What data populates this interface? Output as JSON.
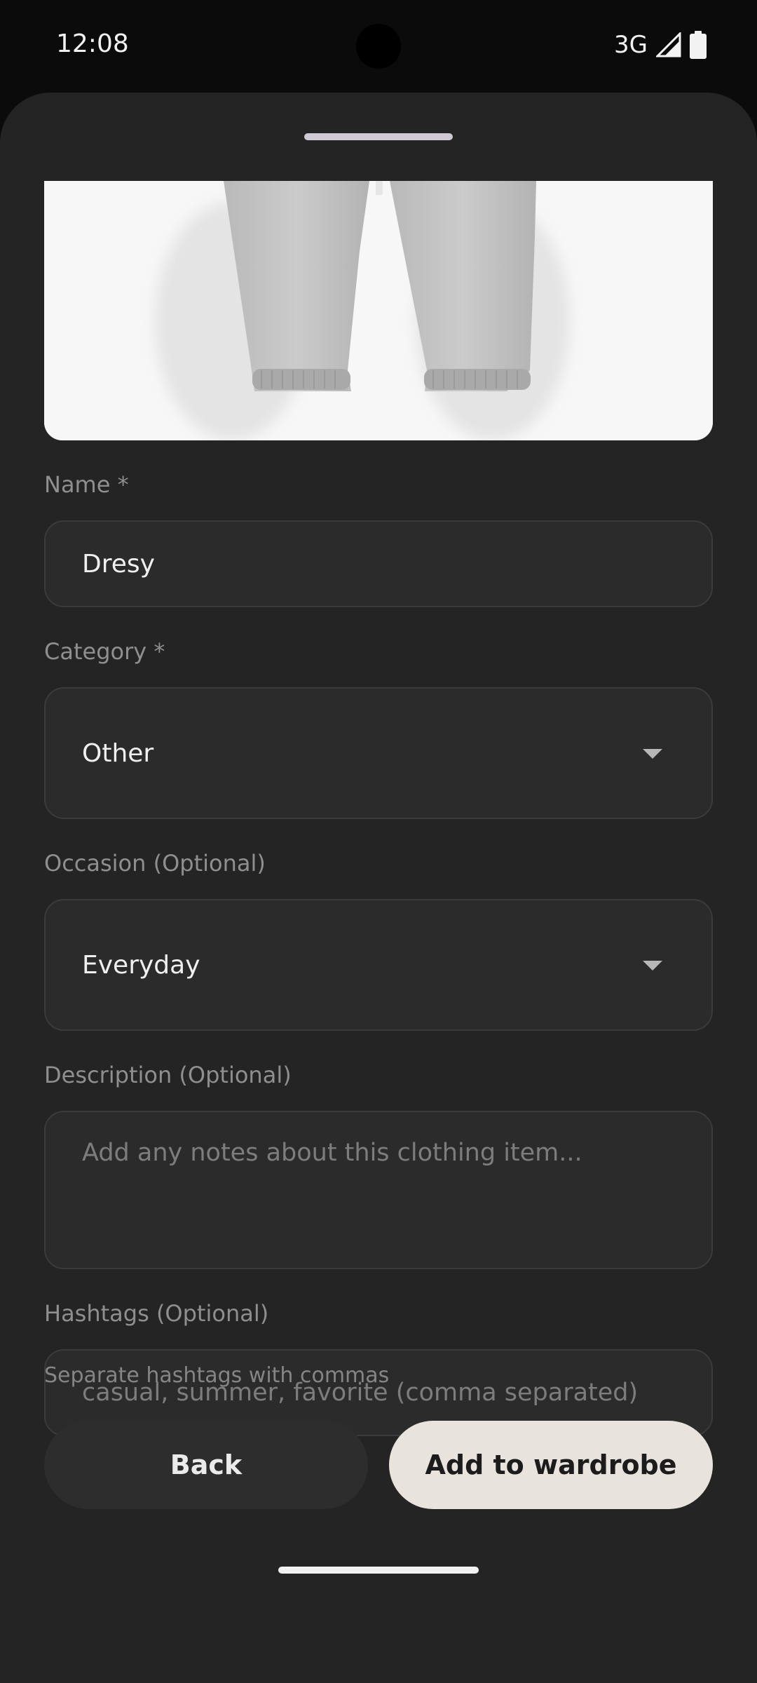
{
  "status_bar": {
    "time": "12:08",
    "network": "3G",
    "icons": [
      "signal-icon",
      "battery-icon"
    ]
  },
  "form": {
    "name": {
      "label": "Name *",
      "value": "Dresy"
    },
    "category": {
      "label": "Category *",
      "value": "Other"
    },
    "occasion": {
      "label": "Occasion (Optional)",
      "value": "Everyday"
    },
    "description": {
      "label": "Description (Optional)",
      "placeholder": "Add any notes about this clothing item..."
    },
    "hashtags": {
      "label": "Hashtags (Optional)",
      "placeholder": "casual, summer, favorite (comma separated)",
      "helper": "Separate hashtags with commas"
    }
  },
  "actions": {
    "back_label": "Back",
    "add_label": "Add to wardrobe"
  },
  "colors": {
    "sheet_background": "#242424",
    "field_background": "#2b2b2b",
    "primary_button": "#e8e3dd"
  }
}
